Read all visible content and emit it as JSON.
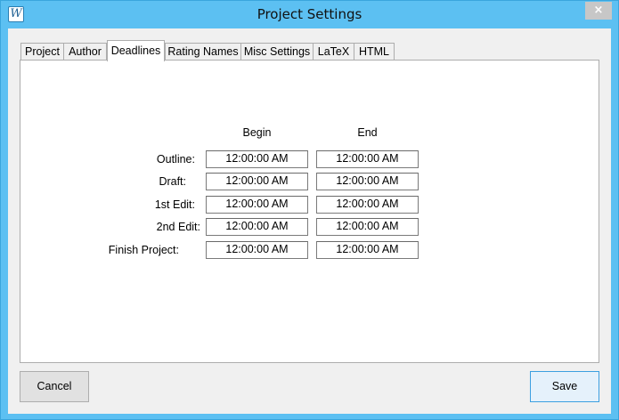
{
  "window": {
    "title": "Project Settings",
    "close_glyph": "×"
  },
  "tabs": [
    {
      "label": "Project"
    },
    {
      "label": "Author"
    },
    {
      "label": "Deadlines",
      "active": true
    },
    {
      "label": "Rating Names"
    },
    {
      "label": "Misc Settings"
    },
    {
      "label": "LaTeX"
    },
    {
      "label": "HTML"
    }
  ],
  "deadlines": {
    "columns": {
      "begin": "Begin",
      "end": "End"
    },
    "rows": [
      {
        "label": "Outline:",
        "begin": "12:00:00 AM",
        "end": "12:00:00 AM"
      },
      {
        "label": "Draft:",
        "begin": "12:00:00 AM",
        "end": "12:00:00 AM"
      },
      {
        "label": "1st Edit:",
        "begin": "12:00:00 AM",
        "end": "12:00:00 AM"
      },
      {
        "label": "2nd Edit:",
        "begin": "12:00:00 AM",
        "end": "12:00:00 AM"
      },
      {
        "label": "Finish Project:",
        "begin": "12:00:00 AM",
        "end": "12:00:00 AM"
      }
    ]
  },
  "buttons": {
    "cancel": "Cancel",
    "save": "Save"
  },
  "colors": {
    "titlebar": "#5cc0f2",
    "default_button_border": "#3c9fe0"
  }
}
